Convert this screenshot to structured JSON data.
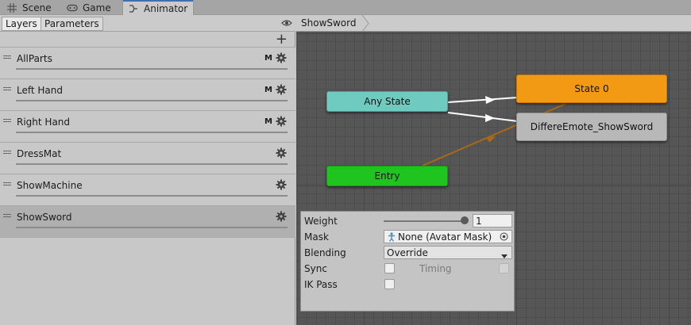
{
  "tabs": [
    {
      "label": "Scene",
      "icon": "grid-icon"
    },
    {
      "label": "Game",
      "icon": "gamepad-icon"
    },
    {
      "label": "Animator",
      "icon": "animator-icon"
    }
  ],
  "left": {
    "subtabs": [
      "Layers",
      "Parameters"
    ],
    "add_label": "+",
    "layers": [
      {
        "name": "AllParts",
        "badge": "M"
      },
      {
        "name": "Left Hand",
        "badge": "M"
      },
      {
        "name": "Right Hand",
        "badge": "M"
      },
      {
        "name": "DressMat",
        "badge": ""
      },
      {
        "name": "ShowMachine",
        "badge": ""
      },
      {
        "name": "ShowSword",
        "badge": ""
      }
    ]
  },
  "graph": {
    "breadcrumb": "ShowSword",
    "nodes": {
      "any_state": "Any State",
      "entry": "Entry",
      "state0": "State 0",
      "emote": "DiffereEmote_ShowSword"
    },
    "colors": {
      "any_state": "#6fcac0",
      "entry": "#20c41f",
      "state0": "#f39a15",
      "emote": "#b8b8b8",
      "default_transition": "#a86a12"
    }
  },
  "inspector": {
    "weight_label": "Weight",
    "weight_value": "1",
    "weight_slider": 1.0,
    "mask_label": "Mask",
    "mask_value": "None (Avatar Mask)",
    "blending_label": "Blending",
    "blending_value": "Override",
    "sync_label": "Sync",
    "timing_label": "Timing",
    "ikpass_label": "IK Pass"
  }
}
